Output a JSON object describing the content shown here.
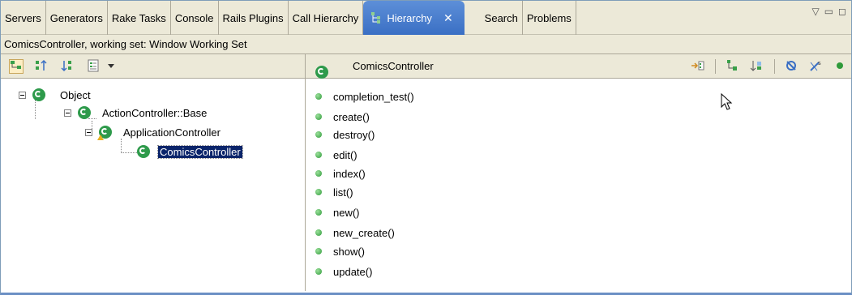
{
  "tabs": [
    {
      "label": "Servers",
      "active": false
    },
    {
      "label": "Generators",
      "active": false
    },
    {
      "label": "Rake Tasks",
      "active": false
    },
    {
      "label": "Console",
      "active": false
    },
    {
      "label": "Rails Plugins",
      "active": false
    },
    {
      "label": "Call Hierarchy",
      "active": false
    },
    {
      "label": "Hierarchy",
      "active": true
    },
    {
      "label": "Search",
      "active": false
    },
    {
      "label": "Problems",
      "active": false
    }
  ],
  "status_line": "ComicsController, working set: Window Working Set",
  "right_header_title": "ComicsController",
  "tree": {
    "nodes": [
      {
        "label": "Object",
        "icon": "class-icon",
        "selected": false
      },
      {
        "label": "ActionController::Base",
        "icon": "class-icon",
        "selected": false
      },
      {
        "label": "ApplicationController",
        "icon": "class-warning-icon",
        "selected": false
      },
      {
        "label": "ComicsController",
        "icon": "class-icon",
        "selected": true
      }
    ]
  },
  "methods": [
    "completion_test()",
    "create()",
    "destroy()",
    "edit()",
    "index()",
    "list()",
    "new()",
    "new_create()",
    "show()",
    "update()"
  ],
  "colors": {
    "active_tab": "#3a6fc4",
    "selection": "#0a246a",
    "class_icon": "#2e9a4b",
    "method_dot": "#2f9a3a",
    "chrome": "#ece9d8"
  }
}
